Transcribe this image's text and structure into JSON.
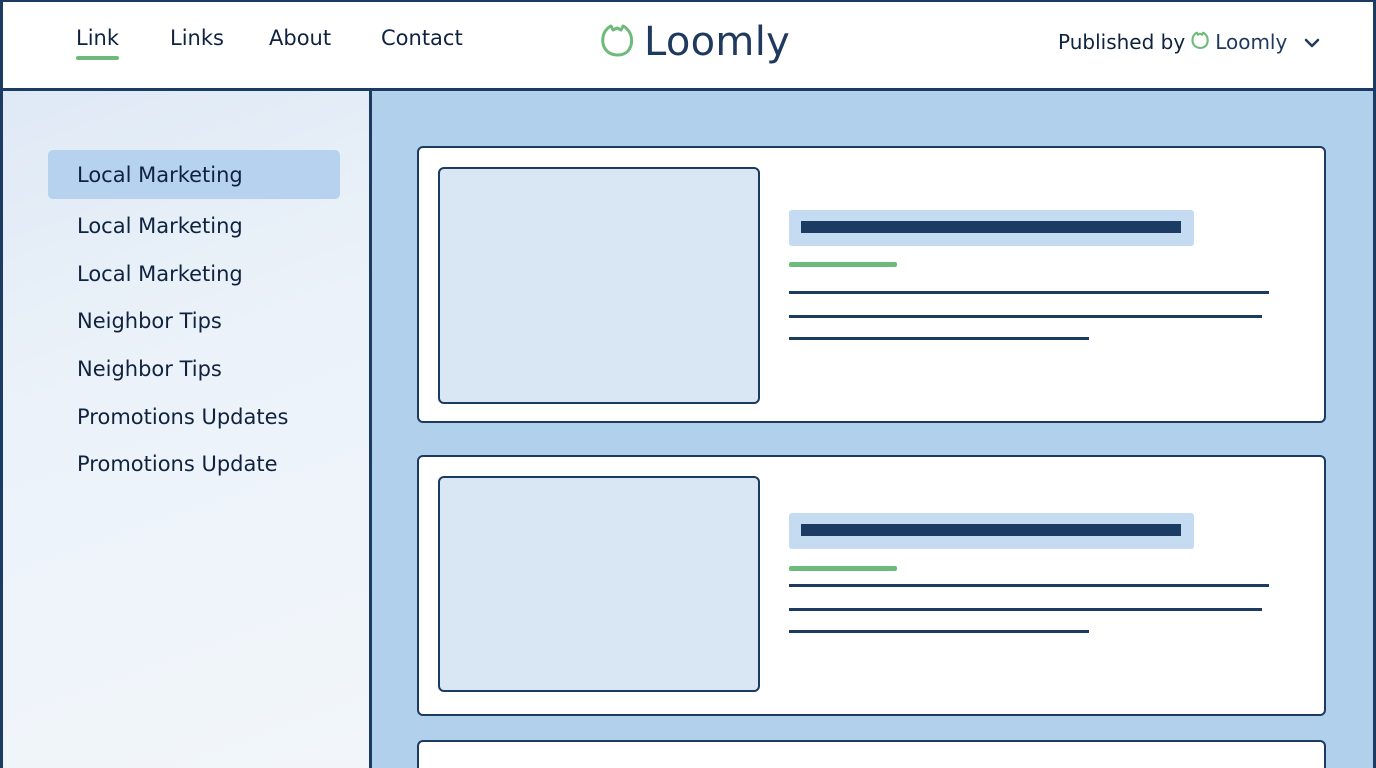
{
  "header": {
    "nav": [
      {
        "label": "Link",
        "active": true
      },
      {
        "label": "Links",
        "active": false
      },
      {
        "label": "About",
        "active": false
      },
      {
        "label": "Contact",
        "active": false
      }
    ],
    "logo_text": "Loomly",
    "publisher": {
      "label": "Published by",
      "brand": "Loomly"
    }
  },
  "sidebar": {
    "items": [
      {
        "label": "Local Marketing",
        "active": true
      },
      {
        "label": "Local Marketing",
        "active": false
      },
      {
        "label": "Local Marketing",
        "active": false
      },
      {
        "label": "Neighbor Tips",
        "active": false
      },
      {
        "label": "Neighbor Tips",
        "active": false
      },
      {
        "label": "Promotions Updates",
        "active": false
      },
      {
        "label": "Promotions Update",
        "active": false
      }
    ]
  },
  "icons": {
    "logo": "loomly-leaf-icon",
    "publisher_logo": "loomly-leaf-icon",
    "dropdown": "chevron-down-icon"
  },
  "colors": {
    "accent_green": "#6dbb7a",
    "navy": "#1c3b63",
    "main_bg": "#b1d0ec",
    "active_item_bg": "#b7d2ee"
  }
}
